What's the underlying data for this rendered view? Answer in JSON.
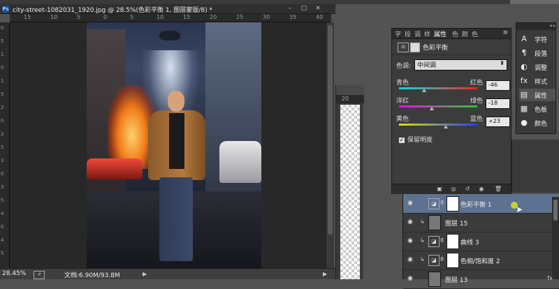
{
  "document": {
    "tab_title": "city-street-1082031_1920.jpg @ 28.5%(色彩平衡 1, 图层蒙版/8) *",
    "ps_badge": "Ps",
    "ruler_h": [
      "15",
      "10",
      "5",
      "0",
      "5",
      "10",
      "15",
      "20",
      "25",
      "30",
      "35",
      "40"
    ],
    "ruler_v": [
      "0",
      "5",
      "1",
      "0",
      "1",
      "5",
      "2",
      "0",
      "2",
      "5",
      "3",
      "0",
      "3",
      "5",
      "4",
      "0",
      "4",
      "5"
    ],
    "status": {
      "zoom": "28.45%",
      "doc_size": "文档:6.90M/93.8M"
    }
  },
  "doc2": {
    "ruler_label": "20"
  },
  "properties_panel": {
    "tabs": [
      "字",
      "段",
      "调",
      "样",
      "属性",
      "色",
      "颜",
      "色"
    ],
    "active_tab": "属性",
    "title": "色彩平衡",
    "tone_label": "色调:",
    "tone_value": "中间调",
    "sliders": [
      {
        "left": "青色",
        "right": "红色",
        "value": "-46",
        "pos": 0.32
      },
      {
        "left": "洋红",
        "right": "绿色",
        "value": "-18",
        "pos": 0.42
      },
      {
        "left": "黄色",
        "right": "蓝色",
        "value": "+23",
        "pos": 0.6
      }
    ],
    "preserve_luminosity": "保留明度"
  },
  "dock": {
    "items": [
      {
        "icon": "A",
        "label": "字符"
      },
      {
        "icon": "¶",
        "label": "段落"
      },
      {
        "icon": "◐",
        "label": "调整"
      },
      {
        "icon": "fx",
        "label": "样式"
      },
      {
        "icon": "▤",
        "label": "属性"
      },
      {
        "icon": "▦",
        "label": "色板"
      },
      {
        "icon": "●",
        "label": "颜色"
      }
    ],
    "active_index": 4
  },
  "layers": [
    {
      "name": "色彩平衡 1",
      "type": "adjustment",
      "selected": true
    },
    {
      "name": "图层 15",
      "type": "pixel",
      "selected": false
    },
    {
      "name": "曲线 3",
      "type": "adjustment",
      "selected": false
    },
    {
      "name": "色相/饱和度 2",
      "type": "adjustment",
      "selected": false
    },
    {
      "name": "图层 13",
      "type": "pixel",
      "selected": false,
      "fx": "fx"
    }
  ],
  "colors": {
    "accent_selected": "#5d7290",
    "cursor_highlight": "#d8e020"
  }
}
